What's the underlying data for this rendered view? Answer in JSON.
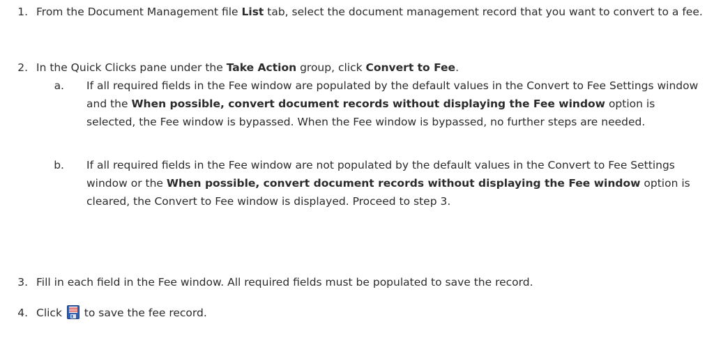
{
  "steps": [
    {
      "num": "1.",
      "t1": "From the Document Management file ",
      "b1": "List",
      "t2": " tab, select the document management record that you want to convert to a fee."
    },
    {
      "num": "2.",
      "t1": "In the Quick Clicks pane under the ",
      "b1": "Take Action",
      "t2": " group, click ",
      "b2": "Convert to Fee",
      "t3": ".",
      "subs": [
        {
          "num": "a.",
          "t1": "If all required fields in the Fee window are populated by the default values in the Convert to Fee Settings window and the ",
          "b1": "When possible, convert document records without displaying the Fee window",
          "t2": " option is selected, the Fee window is bypassed. When the Fee window is bypassed, no further steps are needed."
        },
        {
          "num": "b.",
          "t1": "If all required fields in the Fee window are not populated by the default values in the Convert to Fee Settings window or the ",
          "b1": "When possible, convert document records without displaying the Fee window",
          "t2": " option is cleared, the Convert to Fee window is displayed. Proceed to step 3."
        }
      ]
    },
    {
      "num": "3.",
      "t1": "Fill in each field in the Fee window. All required fields must be populated to save the record."
    },
    {
      "num": "4.",
      "t1": "Click ",
      "icon": "save-icon",
      "t2": " to save the fee record."
    }
  ]
}
